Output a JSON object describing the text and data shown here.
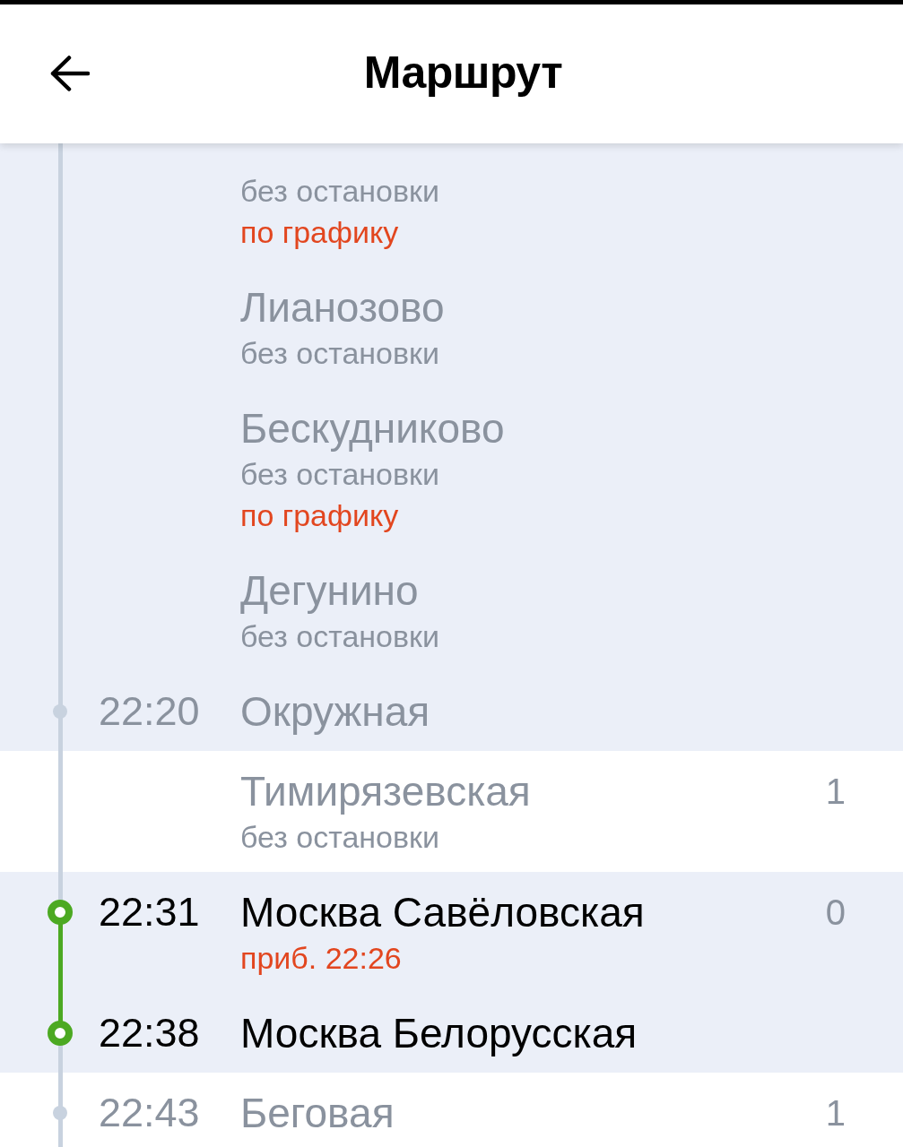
{
  "header": {
    "title": "Маршрут"
  },
  "stops": [
    {
      "notes": [
        {
          "text": "без остановки",
          "kind": "plain"
        },
        {
          "text": "по графику",
          "kind": "alert"
        }
      ],
      "highlighted": true,
      "in_trip": false
    },
    {
      "name": "Лианозово",
      "notes": [
        {
          "text": "без остановки",
          "kind": "plain"
        }
      ],
      "highlighted": true,
      "in_trip": false
    },
    {
      "name": "Бескудниково",
      "notes": [
        {
          "text": "без остановки",
          "kind": "plain"
        },
        {
          "text": "по графику",
          "kind": "alert"
        }
      ],
      "highlighted": true,
      "in_trip": false
    },
    {
      "name": "Дегунино",
      "notes": [
        {
          "text": "без остановки",
          "kind": "plain"
        }
      ],
      "highlighted": true,
      "in_trip": false
    },
    {
      "time": "22:20",
      "name": "Окружная",
      "highlighted": true,
      "in_trip": false
    },
    {
      "name": "Тимирязевская",
      "notes": [
        {
          "text": "без остановки",
          "kind": "plain"
        }
      ],
      "right_value": "1",
      "highlighted": false,
      "in_trip": false
    },
    {
      "time": "22:31",
      "name": "Москва Савёловская",
      "notes": [
        {
          "text": "приб. 22:26",
          "kind": "alert"
        }
      ],
      "right_value": "0",
      "highlighted": true,
      "in_trip": true
    },
    {
      "time": "22:38",
      "name": "Москва Белорусская",
      "highlighted": true,
      "in_trip": true
    },
    {
      "time": "22:43",
      "name": "Беговая",
      "right_value": "1",
      "highlighted": false,
      "in_trip": false
    }
  ]
}
